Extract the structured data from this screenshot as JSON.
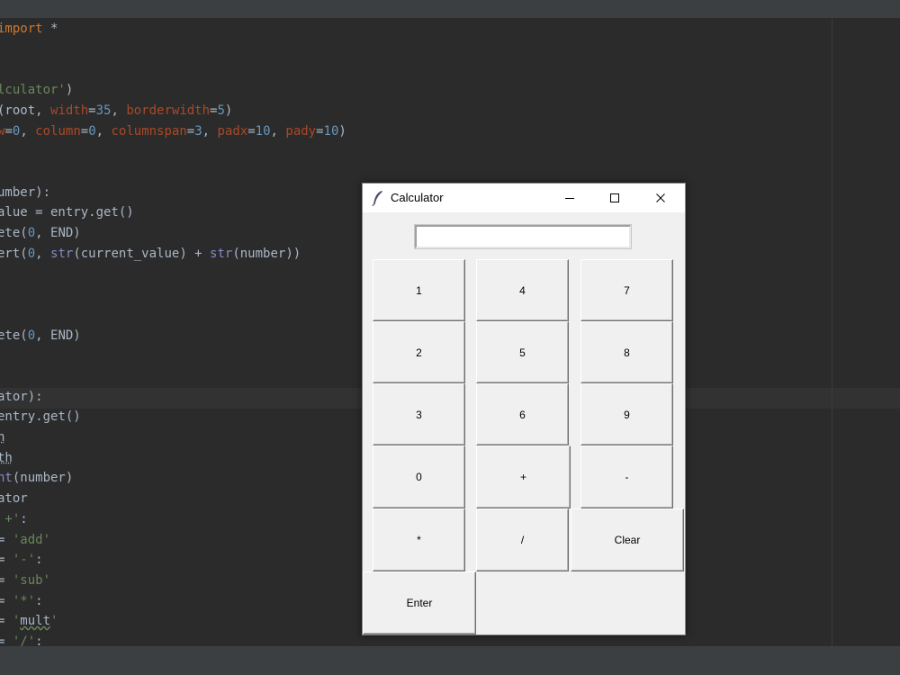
{
  "editor": {
    "lines": [
      [
        {
          "t": "import",
          "c": "kw"
        },
        {
          "t": " *"
        }
      ],
      [],
      [],
      [
        {
          "t": "lculator'",
          "c": "str"
        },
        {
          "t": ")"
        }
      ],
      [
        {
          "t": "(root, "
        },
        {
          "t": "width",
          "c": "prm"
        },
        {
          "t": "="
        },
        {
          "t": "35",
          "c": "num"
        },
        {
          "t": ", "
        },
        {
          "t": "borderwidth",
          "c": "prm"
        },
        {
          "t": "="
        },
        {
          "t": "5",
          "c": "num"
        },
        {
          "t": ")"
        }
      ],
      [
        {
          "t": "w",
          "c": "prm"
        },
        {
          "t": "="
        },
        {
          "t": "0",
          "c": "num"
        },
        {
          "t": ", "
        },
        {
          "t": "column",
          "c": "prm"
        },
        {
          "t": "="
        },
        {
          "t": "0",
          "c": "num"
        },
        {
          "t": ", "
        },
        {
          "t": "columnspan",
          "c": "prm"
        },
        {
          "t": "="
        },
        {
          "t": "3",
          "c": "num"
        },
        {
          "t": ", "
        },
        {
          "t": "padx",
          "c": "prm"
        },
        {
          "t": "="
        },
        {
          "t": "10",
          "c": "num"
        },
        {
          "t": ", "
        },
        {
          "t": "pady",
          "c": "prm"
        },
        {
          "t": "="
        },
        {
          "t": "10",
          "c": "num"
        },
        {
          "t": ")"
        }
      ],
      [],
      [],
      [
        {
          "t": "umber):"
        }
      ],
      [
        {
          "t": "alue = entry.get()"
        }
      ],
      [
        {
          "t": "ete("
        },
        {
          "t": "0",
          "c": "num"
        },
        {
          "t": ", END)"
        }
      ],
      [
        {
          "t": "ert("
        },
        {
          "t": "0",
          "c": "num"
        },
        {
          "t": ", "
        },
        {
          "t": "str",
          "c": "bi"
        },
        {
          "t": "(current_value) + "
        },
        {
          "t": "str",
          "c": "bi"
        },
        {
          "t": "(number))"
        }
      ],
      [],
      [],
      [],
      [
        {
          "t": "ete("
        },
        {
          "t": "0",
          "c": "num"
        },
        {
          "t": ", END)"
        }
      ],
      [],
      [],
      [
        {
          "t": "ator):"
        }
      ],
      [
        {
          "t": "entry.get()"
        }
      ],
      [
        {
          "t": "h",
          "c": "und"
        }
      ],
      [
        {
          "t": "th",
          "c": "und"
        }
      ],
      [
        {
          "t": "nt",
          "c": "bi"
        },
        {
          "t": "(number)"
        }
      ],
      [
        {
          "t": "ator"
        }
      ],
      [
        {
          "t": " +'",
          "c": "str"
        },
        {
          "t": ":"
        }
      ],
      [
        {
          "t": "= "
        },
        {
          "t": "'add'",
          "c": "str"
        }
      ],
      [
        {
          "t": "= "
        },
        {
          "t": "'-'",
          "c": "str"
        },
        {
          "t": ":"
        }
      ],
      [
        {
          "t": "= "
        },
        {
          "t": "'sub'",
          "c": "str"
        }
      ],
      [
        {
          "t": "= "
        },
        {
          "t": "'*'",
          "c": "str"
        },
        {
          "t": ":"
        }
      ],
      [
        {
          "t": "= "
        },
        {
          "t": "'",
          "c": "str"
        },
        {
          "t": "mult",
          "c": "wav"
        },
        {
          "t": "'",
          "c": "str"
        }
      ],
      [
        {
          "t": "= "
        },
        {
          "t": "'/'",
          "c": "str"
        },
        {
          "t": ":"
        }
      ]
    ]
  },
  "window": {
    "title": "Calculator",
    "entry_value": ""
  },
  "buttons": [
    {
      "label": "1",
      "name": "button-1"
    },
    {
      "label": "4",
      "name": "button-4"
    },
    {
      "label": "7",
      "name": "button-7"
    },
    {
      "label": "2",
      "name": "button-2"
    },
    {
      "label": "5",
      "name": "button-5"
    },
    {
      "label": "8",
      "name": "button-8"
    },
    {
      "label": "3",
      "name": "button-3"
    },
    {
      "label": "6",
      "name": "button-6"
    },
    {
      "label": "9",
      "name": "button-9"
    },
    {
      "label": "0",
      "name": "button-0"
    },
    {
      "label": "+",
      "name": "add-button"
    },
    {
      "label": "-",
      "name": "subtract-button"
    },
    {
      "label": "*",
      "name": "multiply-button"
    },
    {
      "label": "/",
      "name": "divide-button"
    },
    {
      "label": "Clear",
      "name": "clear-button"
    },
    {
      "label": "Enter",
      "name": "enter-button"
    }
  ]
}
